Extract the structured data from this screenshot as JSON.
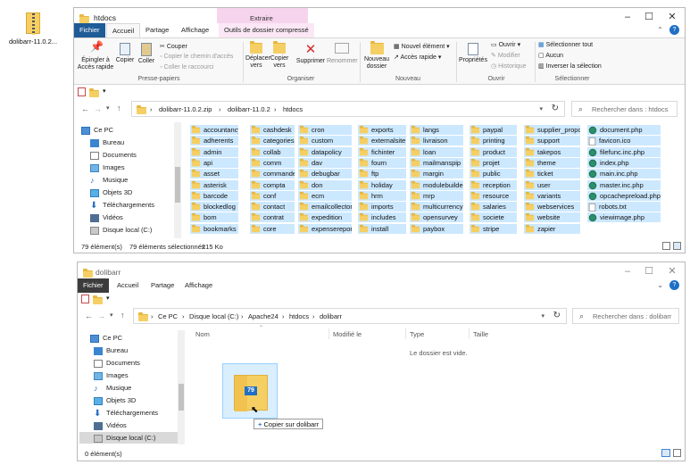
{
  "desktop": {
    "zip_label": "dolibarr-11.0.2..."
  },
  "win1": {
    "title": "htdocs",
    "context_tab": "Extraire",
    "tabs": [
      "Fichier",
      "Accueil",
      "Partage",
      "Affichage",
      "Outils de dossier compressé"
    ],
    "ribbon": {
      "pin": "Épingler à Accès rapide",
      "copy": "Copier",
      "paste": "Coller",
      "cut": "Couper",
      "copy_path": "Copier le chemin d'accès",
      "paste_shortcut": "Coller le raccourci",
      "move_to": "Déplacer vers",
      "copy_to": "Copier vers",
      "delete": "Supprimer",
      "rename": "Renommer",
      "new_folder": "Nouveau dossier",
      "new_item": "Nouvel élément",
      "easy_access": "Accès rapide",
      "properties": "Propriétés",
      "open": "Ouvrir",
      "modify": "Modifier",
      "history": "Historique",
      "select_all": "Sélectionner tout",
      "select_none": "Aucun",
      "invert": "Inverser la sélection",
      "groups": [
        "Presse-papiers",
        "Organiser",
        "Nouveau",
        "Ouvrir",
        "Sélectionner"
      ]
    },
    "breadcrumb": [
      "dolibarr-11.0.2.zip",
      "dolibarr-11.0.2",
      "htdocs"
    ],
    "search_placeholder": "Rechercher dans : htdocs",
    "nav": [
      "Ce PC",
      "Bureau",
      "Documents",
      "Images",
      "Musique",
      "Objets 3D",
      "Téléchargements",
      "Vidéos",
      "Disque local (C:)"
    ],
    "columns": [
      [
        "accountancy",
        "adherents",
        "admin",
        "api",
        "asset",
        "asterisk",
        "barcode",
        "blockedlog",
        "bom",
        "bookmarks"
      ],
      [
        "cashdesk",
        "categories",
        "collab",
        "comm",
        "commande",
        "compta",
        "conf",
        "contact",
        "contrat",
        "core"
      ],
      [
        "cron",
        "custom",
        "datapolicy",
        "dav",
        "debugbar",
        "don",
        "ecm",
        "emailcollector",
        "expedition",
        "expensereport"
      ],
      [
        "exports",
        "externalsite",
        "fichinter",
        "fourn",
        "ftp",
        "holiday",
        "hrm",
        "imports",
        "includes",
        "install"
      ],
      [
        "langs",
        "livraison",
        "loan",
        "mailmanspip",
        "margin",
        "modulebuilder",
        "mrp",
        "multicurrency",
        "opensurvey",
        "paybox"
      ],
      [
        "paypal",
        "printing",
        "product",
        "projet",
        "public",
        "reception",
        "resource",
        "salaries",
        "societe",
        "stripe"
      ],
      [
        "supplier_proposal",
        "support",
        "takepos",
        "theme",
        "ticket",
        "user",
        "variants",
        "webservices",
        "website",
        "zapier"
      ],
      [
        "document.php",
        "favicon.ico",
        "filefunc.inc.php",
        "index.php",
        "main.inc.php",
        "master.inc.php",
        "opcachepreload.php",
        "robots.txt",
        "viewimage.php"
      ]
    ],
    "status_count": "79 élément(s)",
    "status_selected": "79 éléments sélectionnés",
    "status_size": "215 Ko"
  },
  "win2": {
    "title": "dolibarr",
    "tabs": [
      "Fichier",
      "Accueil",
      "Partage",
      "Affichage"
    ],
    "breadcrumb": [
      "Ce PC",
      "Disque local (C:)",
      "Apache24",
      "htdocs",
      "dolibarr"
    ],
    "search_placeholder": "Rechercher dans : dolibarr",
    "nav": [
      "Ce PC",
      "Bureau",
      "Documents",
      "Images",
      "Musique",
      "Objets 3D",
      "Téléchargements",
      "Vidéos",
      "Disque local (C:)"
    ],
    "col_headers": [
      "Nom",
      "Modifié le",
      "Type",
      "Taille"
    ],
    "empty_text": "Le dossier est vide.",
    "drag_count": "79",
    "drag_tooltip": "Copier sur dolibarr",
    "status_count": "0 élément(s)"
  }
}
